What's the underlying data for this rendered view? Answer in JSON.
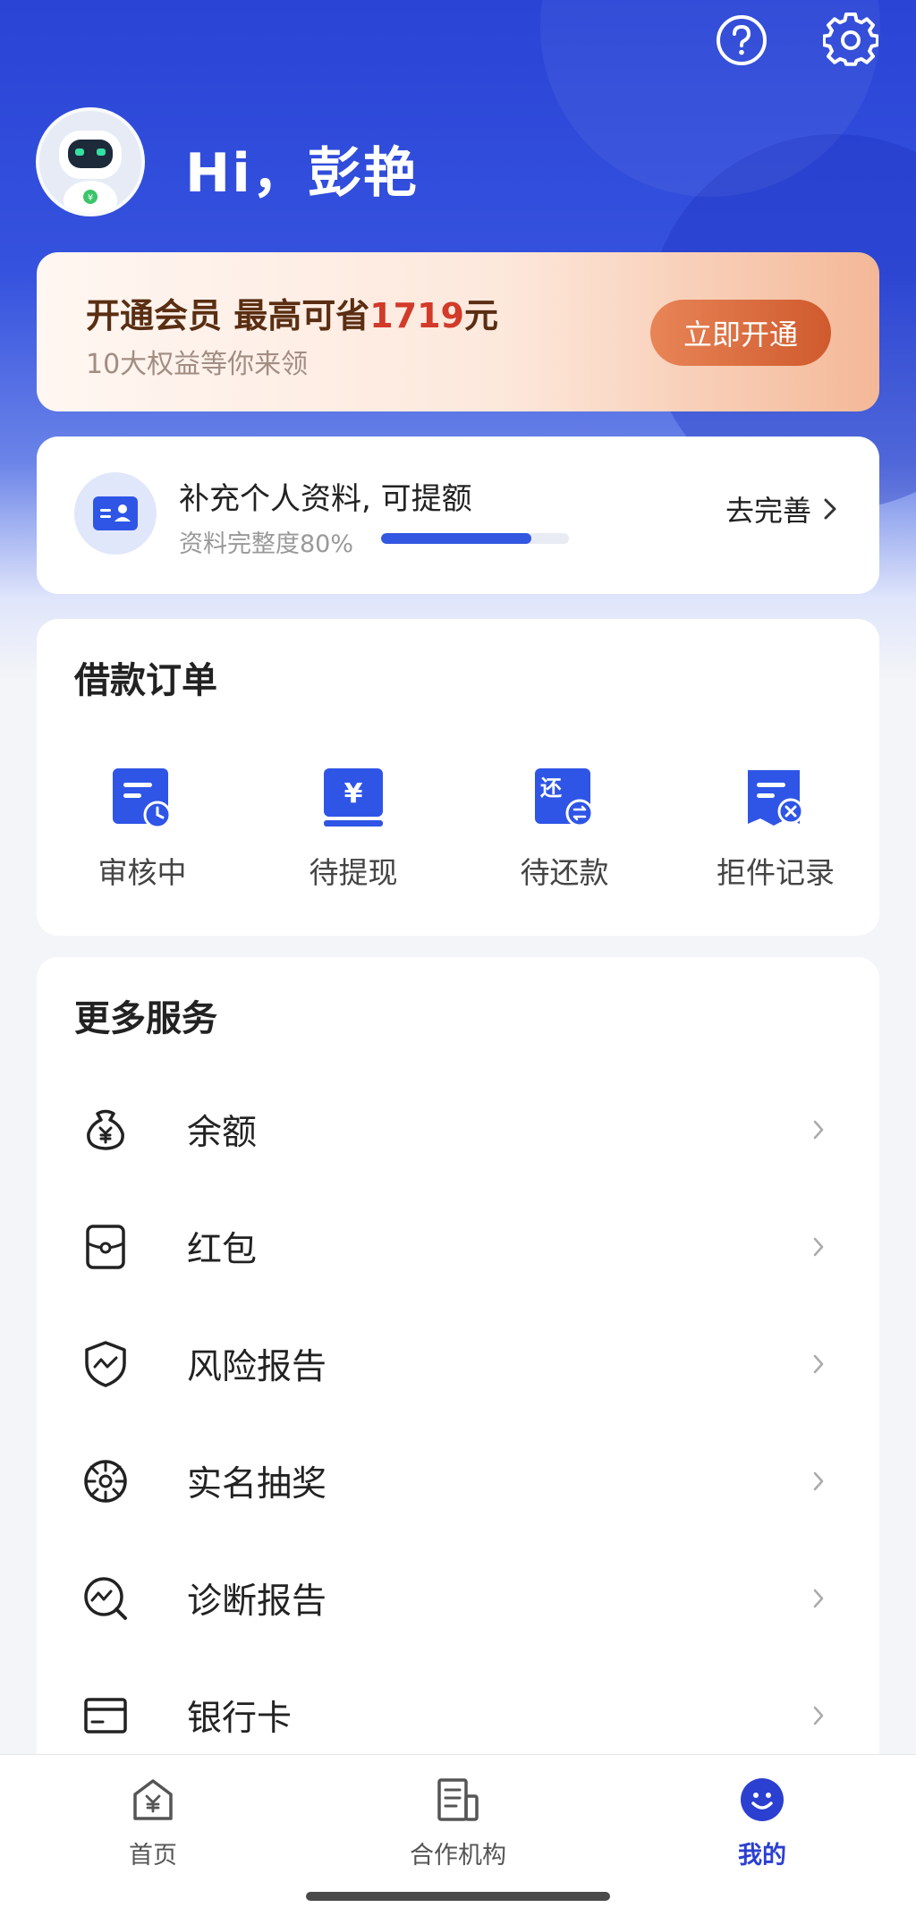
{
  "header": {
    "greeting": "Hi，彭艳",
    "help_icon": "question-circle-icon",
    "settings_icon": "gear-icon"
  },
  "membership": {
    "title_prefix": "开通会员 最高可省",
    "amount": "1719",
    "title_suffix": "元",
    "subtitle": "10大权益等你来领",
    "button": "立即开通"
  },
  "profile": {
    "title": "补充个人资料, 可提额",
    "progress_label": "资料完整度80%",
    "progress": 0.8,
    "action": "去完善"
  },
  "loan_orders": {
    "title": "借款订单",
    "items": [
      {
        "label": "审核中",
        "icon": "reviewing-icon"
      },
      {
        "label": "待提现",
        "icon": "withdraw-icon"
      },
      {
        "label": "待还款",
        "icon": "repay-icon"
      },
      {
        "label": "拒件记录",
        "icon": "rejected-icon"
      }
    ],
    "icon_text_withdraw": "¥",
    "icon_text_repay": "还"
  },
  "services": {
    "title": "更多服务",
    "items": [
      {
        "label": "余额",
        "icon": "money-bag-icon"
      },
      {
        "label": "红包",
        "icon": "red-packet-icon"
      },
      {
        "label": "风险报告",
        "icon": "shield-icon"
      },
      {
        "label": "实名抽奖",
        "icon": "lottery-icon"
      },
      {
        "label": "诊断报告",
        "icon": "diagnosis-icon"
      },
      {
        "label": "银行卡",
        "icon": "bank-card-icon"
      }
    ]
  },
  "tabbar": {
    "items": [
      {
        "label": "首页",
        "icon": "home-icon"
      },
      {
        "label": "合作机构",
        "icon": "institution-icon"
      },
      {
        "label": "我的",
        "icon": "smile-icon",
        "active": true
      }
    ]
  },
  "colors": {
    "brand_blue": "#2a44d6",
    "accent_orange": "#cf5a2d",
    "highlight_red": "#d23a2a",
    "progress_blue": "#3257e0"
  }
}
